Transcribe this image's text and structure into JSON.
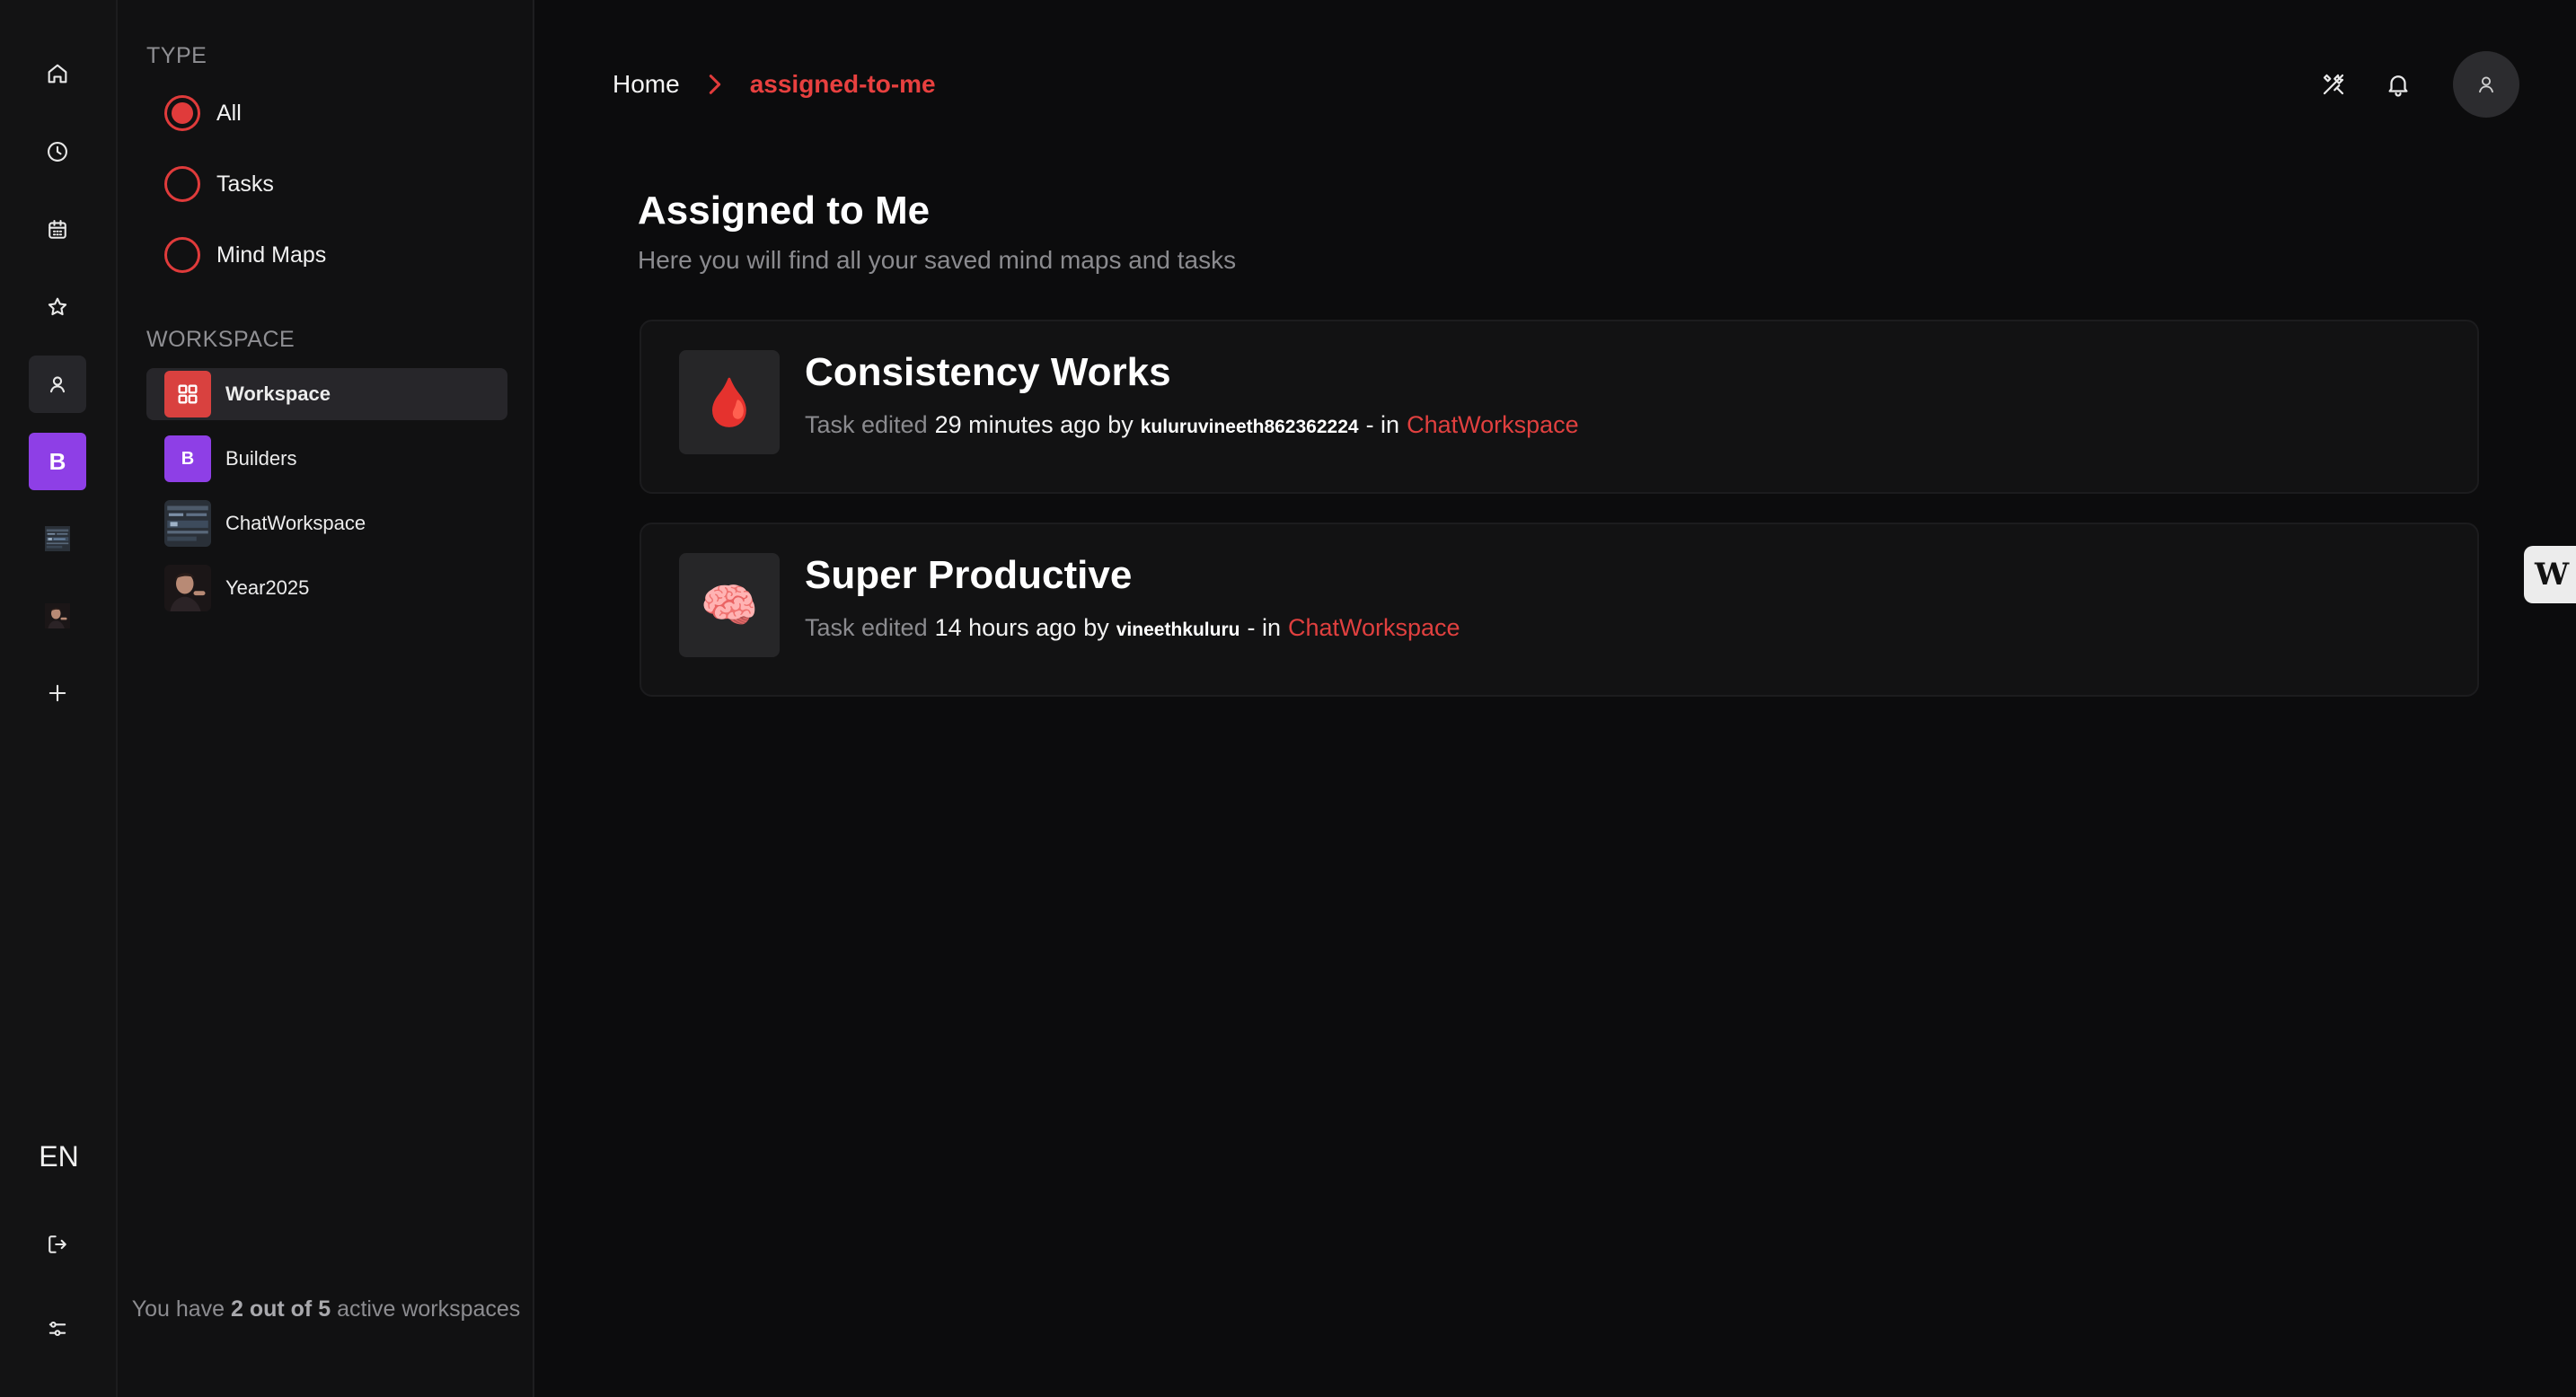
{
  "rail": {
    "workspace_b_letter": "B",
    "language": "EN"
  },
  "filters": {
    "type_title": "TYPE",
    "type_options": [
      "All",
      "Tasks",
      "Mind Maps"
    ],
    "selected_type": "All",
    "workspace_title": "WORKSPACE",
    "workspaces": [
      {
        "label": "Workspace",
        "icon": "grid-icon",
        "active": true
      },
      {
        "label": "Builders",
        "letter": "B",
        "active": false
      },
      {
        "label": "ChatWorkspace",
        "icon": "image-thumbnail",
        "active": false
      },
      {
        "label": "Year2025",
        "icon": "photo-avatar",
        "active": false
      }
    ],
    "footer_prefix": "You have",
    "footer_count": "2 out of 5",
    "footer_suffix": "active workspaces"
  },
  "header": {
    "home": "Home",
    "current": "assigned-to-me"
  },
  "main": {
    "title": "Assigned to Me",
    "subtitle": "Here you will find all your saved mind maps and tasks",
    "items": [
      {
        "title": "Consistency Works",
        "emoji": "🩸",
        "action": "Task edited",
        "when": "29 minutes ago",
        "by": "by",
        "user": "kuluruvineeth862362224",
        "in": "- in",
        "workspace": "ChatWorkspace"
      },
      {
        "title": "Super Productive",
        "emoji": "🧠",
        "action": "Task edited",
        "when": "14 hours ago",
        "by": "by",
        "user": "vineethkuluru",
        "in": "- in",
        "workspace": "ChatWorkspace"
      }
    ]
  },
  "side_tab": {
    "label": "W"
  },
  "colors": {
    "accent": "#e03b3b",
    "background": "#0c0c0d",
    "workspace_purple": "#8e3fe6"
  }
}
